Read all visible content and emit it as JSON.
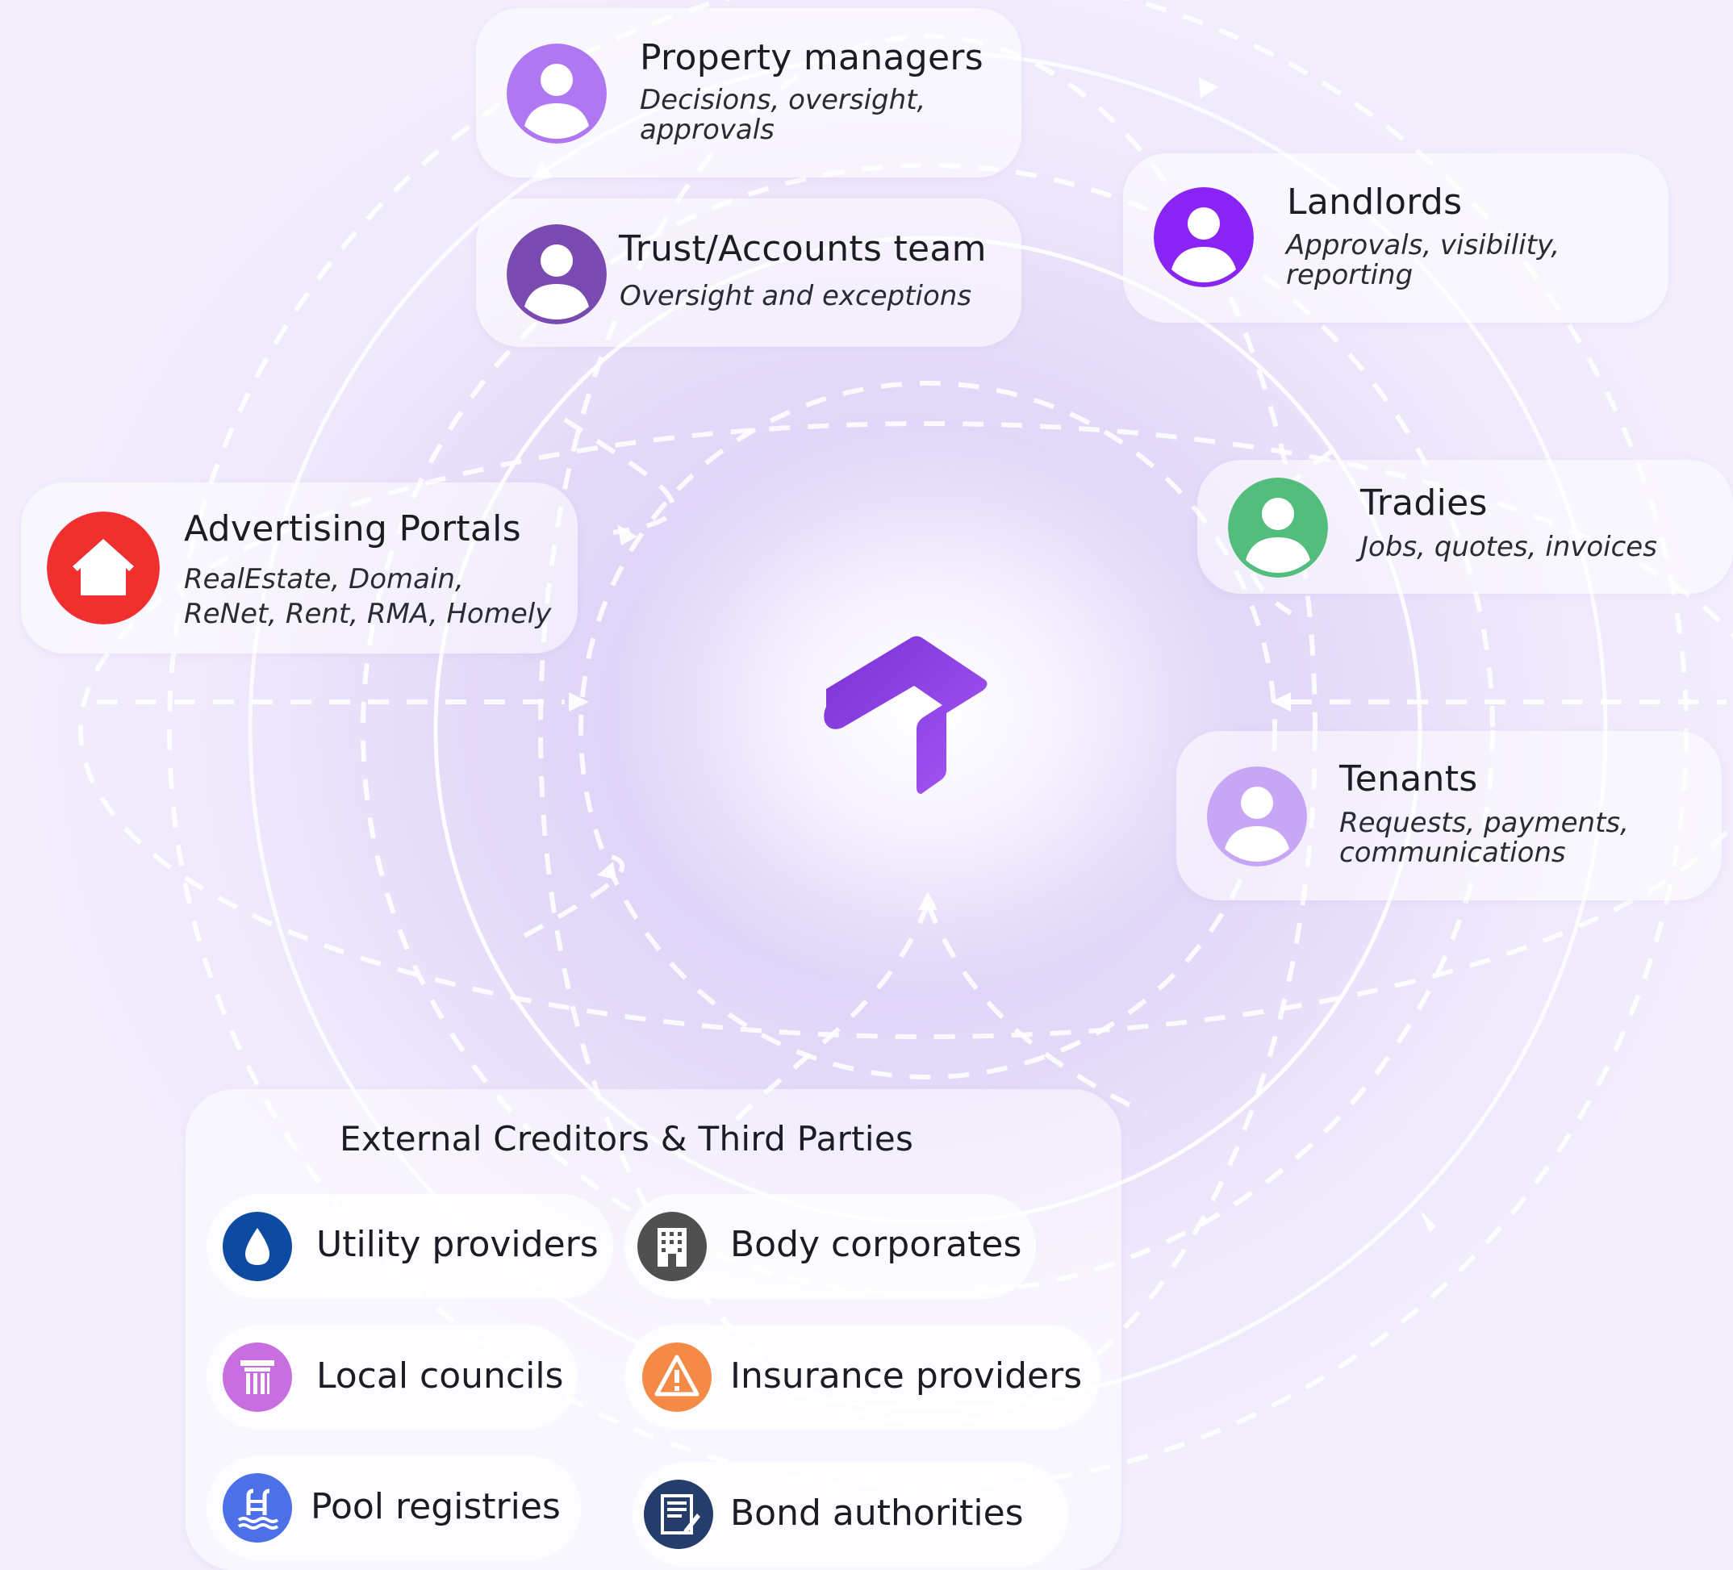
{
  "actors": {
    "property_managers": {
      "title": "Property managers",
      "subtitle": "Decisions, oversight, approvals",
      "color": "#b077f2"
    },
    "trust_accounts": {
      "title": "Trust/Accounts team",
      "subtitle": "Oversight and exceptions",
      "color": "#7a4ab0"
    },
    "landlords": {
      "title": "Landlords",
      "subtitle": "Approvals, visibility, reporting",
      "color": "#8a24f5"
    },
    "advertising": {
      "title": "Advertising Portals",
      "subtitle": "RealEstate, Domain, ReNet, Rent, RMA, Homely",
      "color": "#f02f2f"
    },
    "tradies": {
      "title": "Tradies",
      "subtitle": "Jobs, quotes, invoices",
      "color": "#52bd7c"
    },
    "tenants": {
      "title": "Tenants",
      "subtitle": "Requests, payments, communications",
      "color": "#c8a6f6"
    }
  },
  "center_logo": {
    "icon": "house-logo-icon",
    "color": "#8a3ee6"
  },
  "external": {
    "title": "External Creditors & Third Parties",
    "items": [
      {
        "label": "Utility providers",
        "icon": "water-drop-icon",
        "color": "#0d4ba3"
      },
      {
        "label": "Body corporates",
        "icon": "building-icon",
        "color": "#505050"
      },
      {
        "label": "Local councils",
        "icon": "council-pillar-icon",
        "color": "#c86ee0"
      },
      {
        "label": "Insurance providers",
        "icon": "warning-icon",
        "color": "#f48a45"
      },
      {
        "label": "Pool registries",
        "icon": "pool-ladder-icon",
        "color": "#4d6fe8"
      },
      {
        "label": "Bond authorities",
        "icon": "document-icon",
        "color": "#253d6b"
      }
    ]
  }
}
